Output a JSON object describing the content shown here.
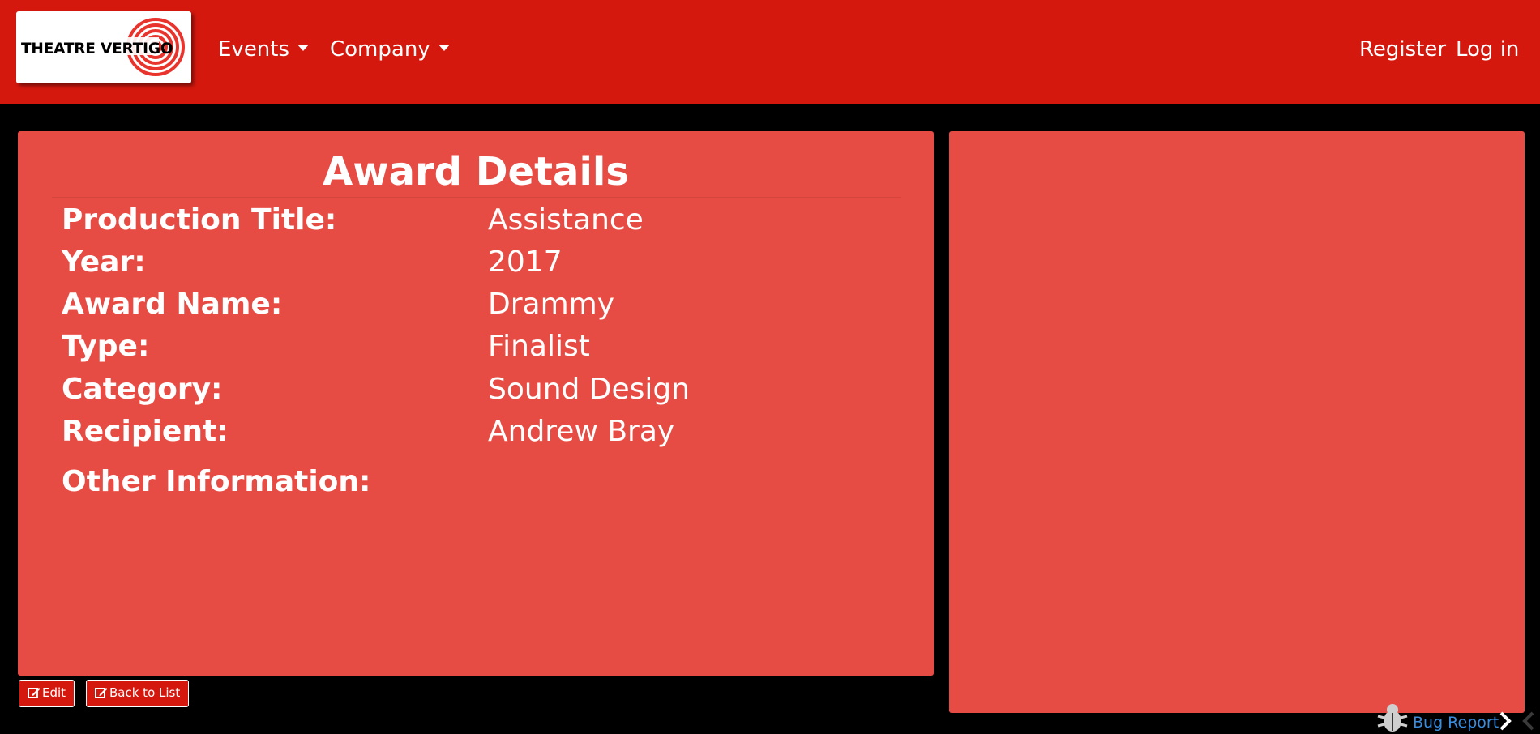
{
  "brand": {
    "logo_text": "THEATRE VERTIGO"
  },
  "nav": {
    "events": "Events",
    "company": "Company",
    "register": "Register",
    "login": "Log in"
  },
  "details": {
    "title": "Award Details",
    "fields": [
      {
        "label": "Production Title:",
        "value": "Assistance"
      },
      {
        "label": "Year:",
        "value": "2017"
      },
      {
        "label": "Award Name:",
        "value": "Drammy"
      },
      {
        "label": "Type:",
        "value": "Finalist"
      },
      {
        "label": "Category:",
        "value": "Sound Design"
      },
      {
        "label": "Recipient:",
        "value": "Andrew Bray"
      },
      {
        "label": "Other Information:",
        "value": ""
      }
    ]
  },
  "actions": {
    "edit": "Edit",
    "back": "Back to List"
  },
  "footer": {
    "bug_report": "Bug Report"
  },
  "icons": {
    "edit": "edit-icon",
    "back": "edit-icon",
    "bug": "bug-icon",
    "chevron_right": "chevron-right-icon",
    "chevron_left": "chevron-left-icon"
  },
  "colors": {
    "navbar": "#d4180e",
    "panel": "#e74c44",
    "background": "#000000",
    "link": "#3a8dde"
  }
}
